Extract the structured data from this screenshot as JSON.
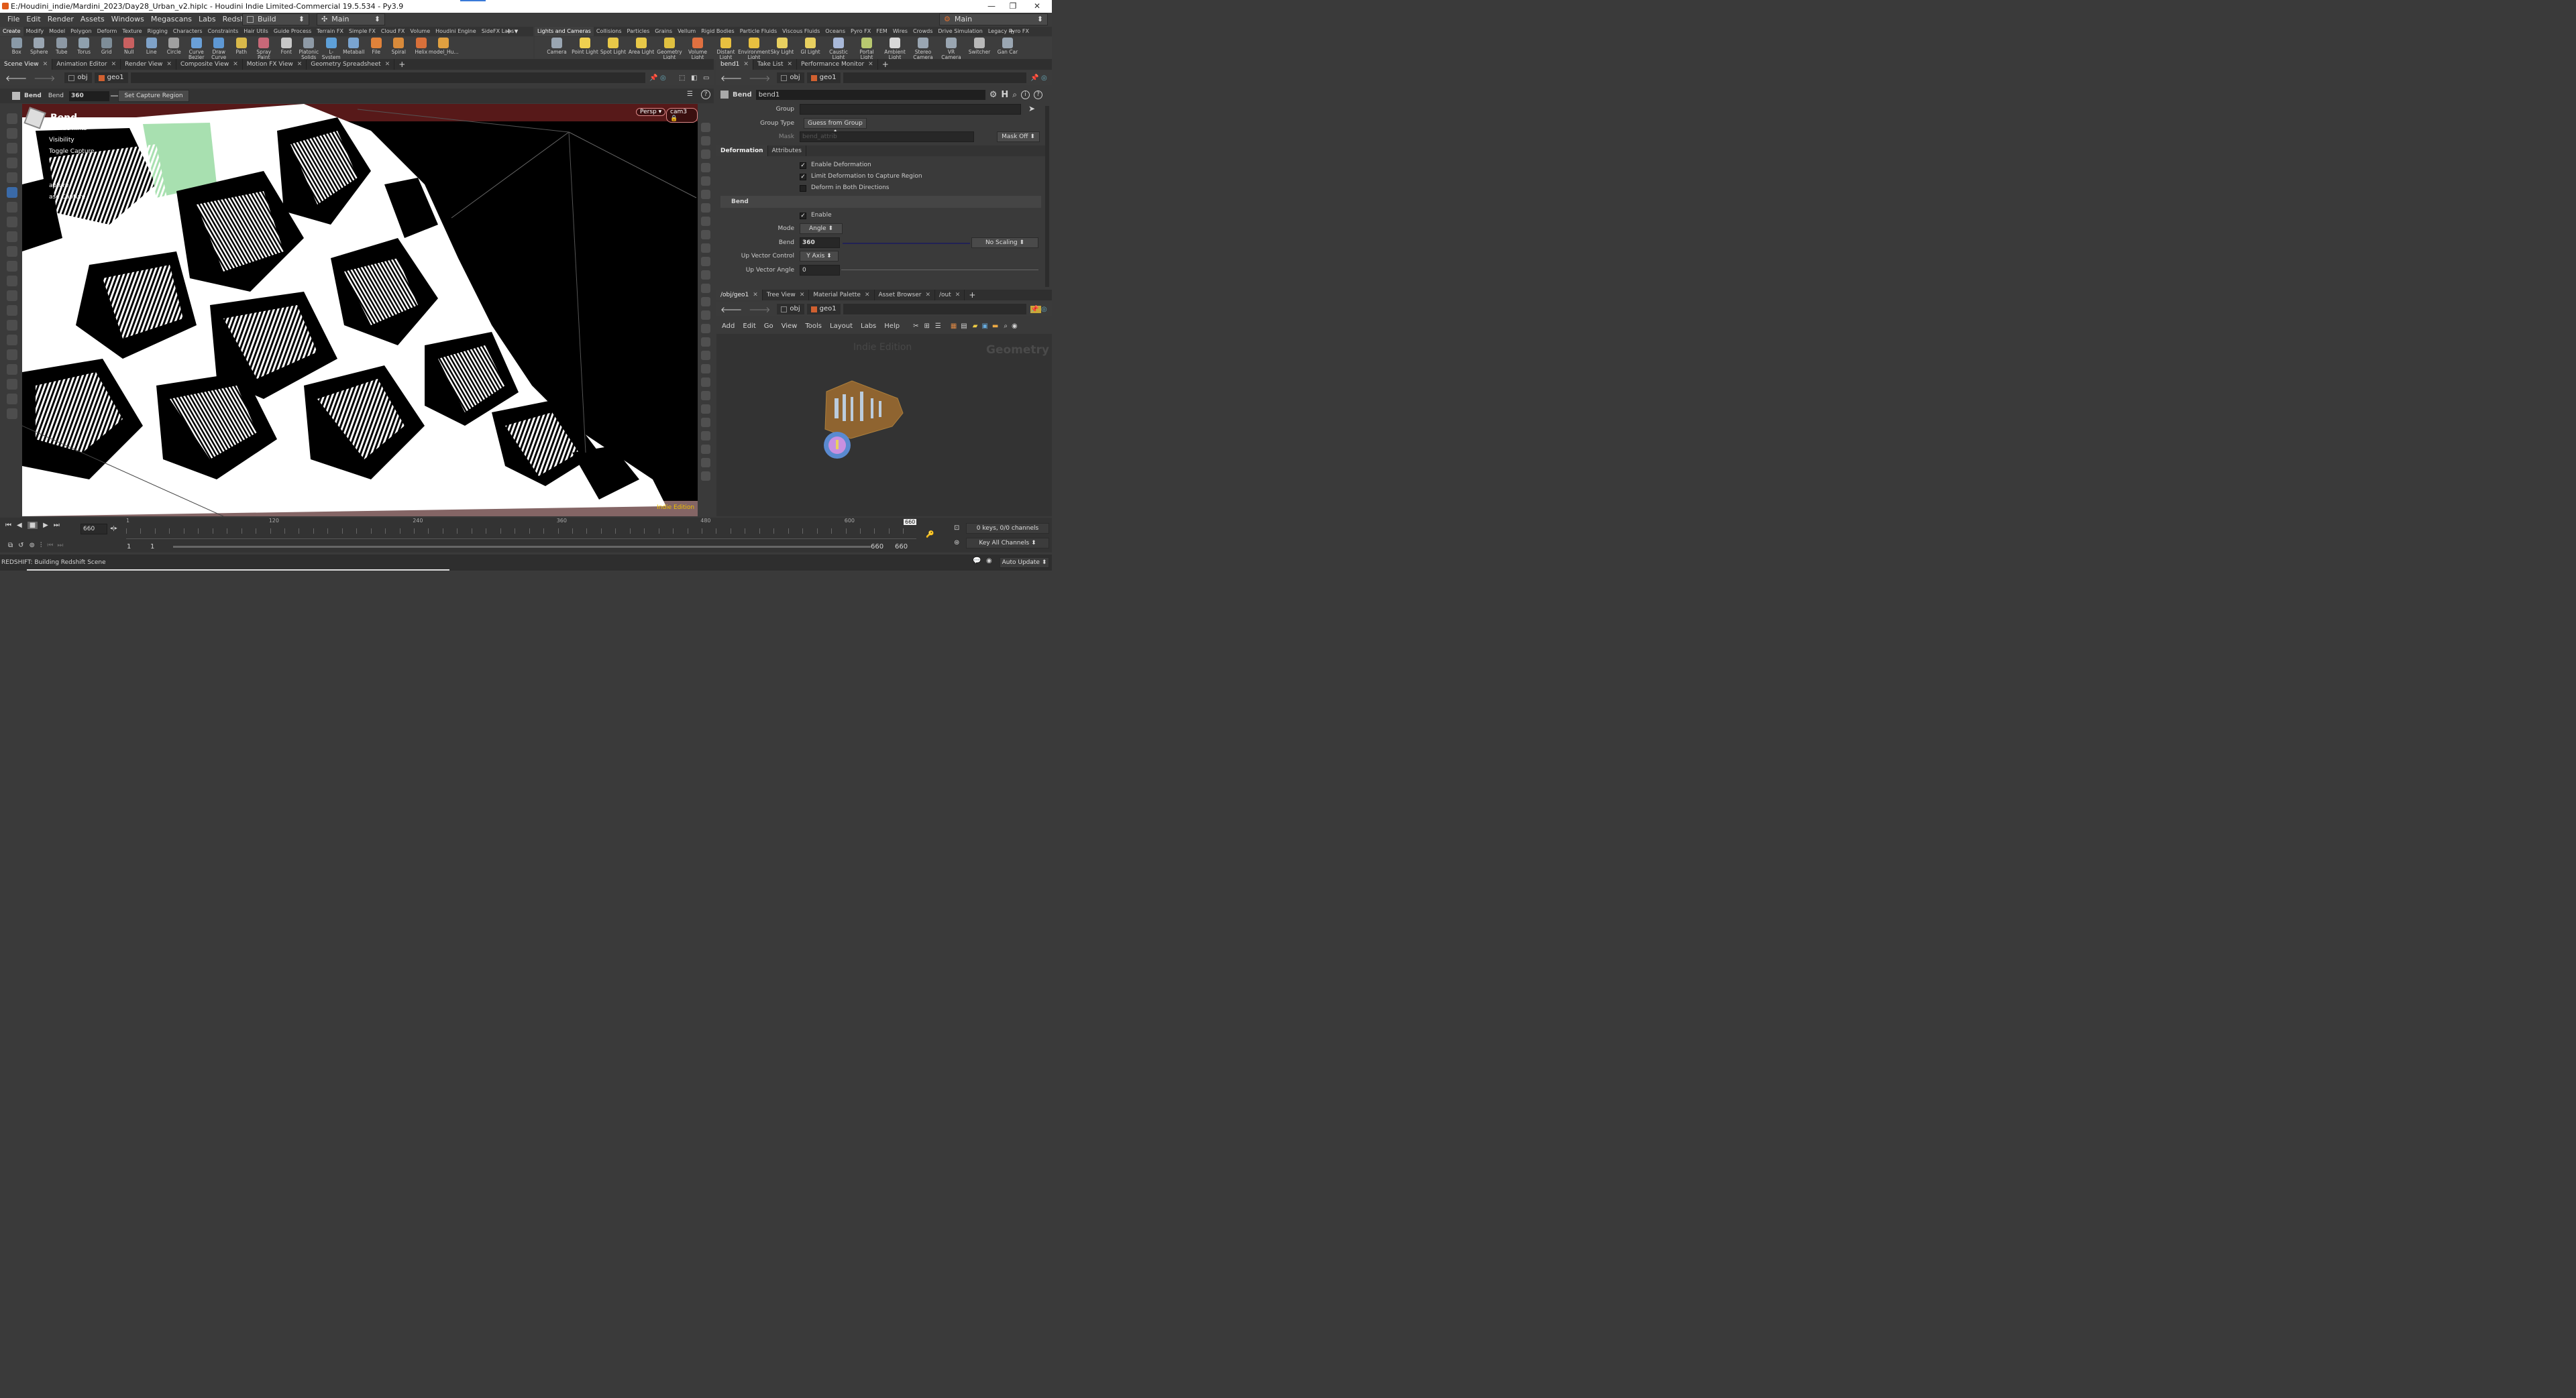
{
  "window": {
    "title": "E:/Houdini_indie/Mardini_2023/Day28_Urban_v2.hiplc - Houdini Indie Limited-Commercial 19.5.534 - Py3.9"
  },
  "menu": [
    "File",
    "Edit",
    "Render",
    "Assets",
    "Windows",
    "Megascans",
    "Labs",
    "Redshift",
    "Help"
  ],
  "desktop_dd": "Build",
  "context_dd": "Main",
  "right_dd": "Main",
  "shelf_left_tabs": [
    "Create",
    "Modify",
    "Model",
    "Polygon",
    "Deform",
    "Texture",
    "Rigging",
    "Characters",
    "Constraints",
    "Hair Utils",
    "Guide Process",
    "Terrain FX",
    "Simple FX",
    "Cloud FX",
    "Volume",
    "Houdini Engine",
    "SideFX Labs"
  ],
  "shelf_right_tabs": [
    "Lights and Cameras",
    "Collisions",
    "Particles",
    "Grains",
    "Vellum",
    "Rigid Bodies",
    "Particle Fluids",
    "Viscous Fluids",
    "Oceans",
    "Pyro FX",
    "FEM",
    "Wires",
    "Crowds",
    "Drive Simulation",
    "Legacy Pyro FX"
  ],
  "tools_left": [
    {
      "label": "Box",
      "color": "#8a9aa8"
    },
    {
      "label": "Sphere",
      "color": "#9aa6b2"
    },
    {
      "label": "Tube",
      "color": "#8c98a4"
    },
    {
      "label": "Torus",
      "color": "#8fa0ad"
    },
    {
      "label": "Grid",
      "color": "#7e8d98"
    },
    {
      "label": "Null",
      "color": "#c86060"
    },
    {
      "label": "Line",
      "color": "#7fa2c8"
    },
    {
      "label": "Circle",
      "color": "#a0a0a0"
    },
    {
      "label": "Curve Bezier",
      "color": "#6aa0d8"
    },
    {
      "label": "Draw Curve",
      "color": "#5e98d4"
    },
    {
      "label": "Path",
      "color": "#d8b84a"
    },
    {
      "label": "Spray Paint",
      "color": "#c86878"
    },
    {
      "label": "Font",
      "color": "#c8c8c8"
    },
    {
      "label": "Platonic Solids",
      "color": "#8e9aa6"
    },
    {
      "label": "L-System",
      "color": "#5ea0d8"
    },
    {
      "label": "Metaball",
      "color": "#7aa4d0"
    },
    {
      "label": "File",
      "color": "#e0823a"
    },
    {
      "label": "Spiral",
      "color": "#d88a3a"
    },
    {
      "label": "Helix",
      "color": "#d8703a"
    },
    {
      "label": "model_Hu...",
      "color": "#e0a040"
    }
  ],
  "tools_right": [
    {
      "label": "Camera",
      "color": "#9aa6b2"
    },
    {
      "label": "Point Light",
      "color": "#f0d050"
    },
    {
      "label": "Spot Light",
      "color": "#e8c848"
    },
    {
      "label": "Area Light",
      "color": "#e8c848"
    },
    {
      "label": "Geometry Light",
      "color": "#e0c040"
    },
    {
      "label": "Volume Light",
      "color": "#e07040"
    },
    {
      "label": "Distant Light",
      "color": "#e8c040"
    },
    {
      "label": "Environment Light",
      "color": "#e8c040"
    },
    {
      "label": "Sky Light",
      "color": "#e8d060"
    },
    {
      "label": "GI Light",
      "color": "#e8d060"
    },
    {
      "label": "Caustic Light",
      "color": "#a8b8d8"
    },
    {
      "label": "Portal Light",
      "color": "#b8c870"
    },
    {
      "label": "Ambient Light",
      "color": "#d8d8d8"
    },
    {
      "label": "Stereo Camera",
      "color": "#9aa6b2"
    },
    {
      "label": "VR Camera",
      "color": "#9aa6b2"
    },
    {
      "label": "Switcher",
      "color": "#b8b8b8"
    },
    {
      "label": "Gan Car",
      "color": "#9aa6b2"
    }
  ],
  "left_pane_tabs": [
    "Scene View",
    "Animation Editor",
    "Render View",
    "Composite View",
    "Motion FX View",
    "Geometry Spreadsheet"
  ],
  "path_obj": "obj",
  "path_geo": "geo1",
  "viewport": {
    "op_label1": "Bend",
    "op_label2": "Bend",
    "op_value": "360",
    "capture_btn": "Set Capture Region",
    "hud_title": "Bend",
    "hints": [
      {
        "key": "",
        "text": "to hide hints"
      },
      {
        "key": "",
        "text": "Visibility"
      },
      {
        "key": "G",
        "text": "Toggle Capture"
      },
      {
        "key": "H",
        "text": ""
      },
      {
        "key": "",
        "text": ""
      },
      {
        "key": "",
        "text": "apture"
      },
      {
        "key": "",
        "text": "ase Capture"
      }
    ],
    "persp": "Persp",
    "cam": "cam3",
    "watermark": "Indie Edition"
  },
  "right_top_tabs": [
    "bend1",
    "Take List",
    "Performance Monitor"
  ],
  "params": {
    "type": "Bend",
    "name": "bend1",
    "group_label": "Group",
    "group_type_label": "Group Type",
    "group_type": "Guess from Group",
    "mask_label": "Mask",
    "mask_value": "bend_attrib",
    "mask_off": "Mask Off",
    "tabs": [
      "Deformation",
      "Attributes"
    ],
    "enable_deformation": "Enable Deformation",
    "limit_deformation": "Limit Deformation to Capture Region",
    "deform_both": "Deform in Both Directions",
    "bend_section": "Bend",
    "enable": "Enable",
    "mode_label": "Mode",
    "mode": "Angle",
    "bend_label": "Bend",
    "bend_value": "360",
    "no_scaling": "No Scaling",
    "up_vector_label": "Up Vector Control",
    "up_vector": "Y Axis",
    "up_angle_label": "Up Vector Angle",
    "up_angle": "0"
  },
  "network_tabs": [
    "/obj/geo1",
    "Tree View",
    "Material Palette",
    "Asset Browser",
    "/out"
  ],
  "network_menu": [
    "Add",
    "Edit",
    "Go",
    "View",
    "Tools",
    "Layout",
    "Labs",
    "Help"
  ],
  "network": {
    "indie": "Indie Edition",
    "context": "Geometry"
  },
  "timeline": {
    "frame": "660",
    "ticks": [
      "1",
      "120",
      "240",
      "360",
      "480",
      "600"
    ],
    "end_marker": "660",
    "start1": "1",
    "start2": "1",
    "end1": "660",
    "end2": "660",
    "keys": "0 keys, 0/0 channels",
    "key_all": "Key All Channels",
    "auto_update": "Auto Update"
  },
  "status": "REDSHIFT: Building Redshift Scene"
}
